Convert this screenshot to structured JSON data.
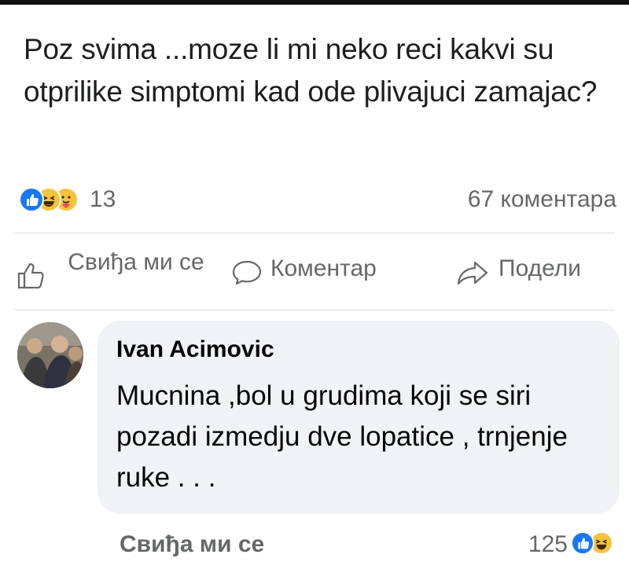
{
  "post": {
    "text": "Poz svima ...moze li mi neko reci kakvi su otprilike simptomi kad ode plivajuci zamajac?"
  },
  "stats": {
    "reaction_count": "13",
    "reactions": [
      "like-icon",
      "haha-icon",
      "care-icon"
    ],
    "comment_count": "67 коментара"
  },
  "actions": {
    "like_label": "Свиђа ми се",
    "comment_label": "Коментар",
    "share_label": "Подели"
  },
  "comment": {
    "author": "Ivan Acimovic",
    "text": "Mucnina ,bol u grudima koji se siri pozadi izmedju dve lopatice , trnjenje ruke  . . .",
    "like_label": "Свиђа ми се",
    "reaction_count": "125",
    "reactions": [
      "like-icon",
      "haha-icon"
    ]
  },
  "colors": {
    "text": "#1c1e21",
    "secondary": "#65676b",
    "bubble": "#f0f2f5",
    "like_blue": "#1877f2",
    "emoji_yellow": "#f7c33b"
  }
}
